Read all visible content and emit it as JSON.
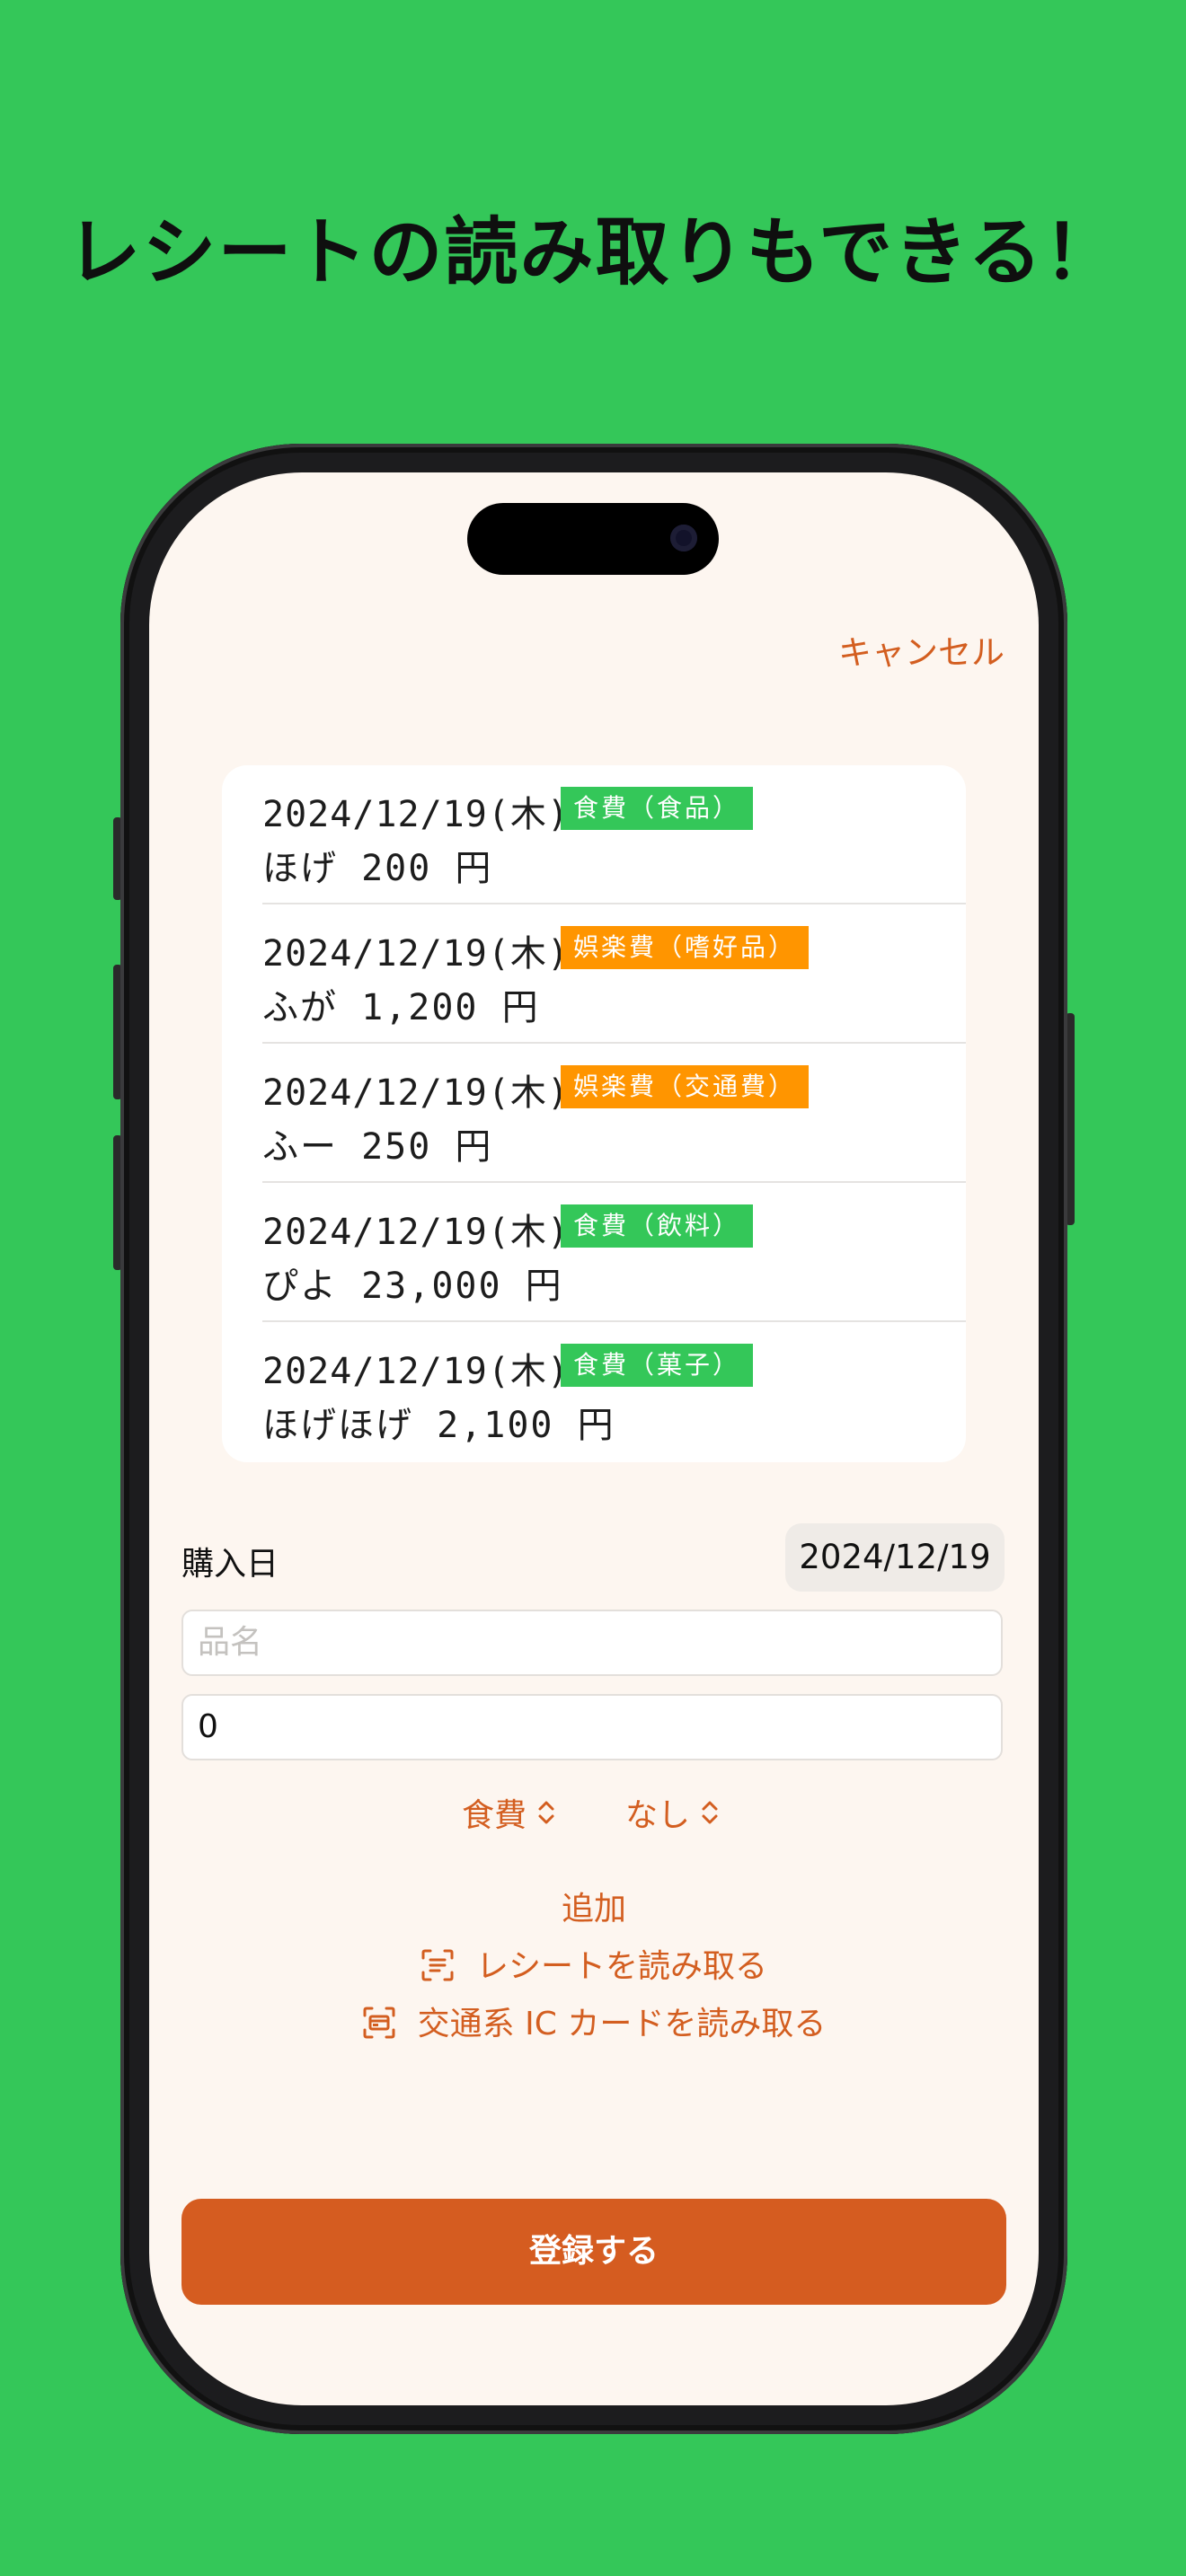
{
  "headline": "レシートの読み取りもできる！",
  "colors": {
    "background": "#34c759",
    "accent": "#d35e20",
    "tag_food": "#34c759",
    "tag_entertainment": "#ff9500"
  },
  "header": {
    "cancel_label": "キャンセル"
  },
  "entries": [
    {
      "date": "2024/12/19(木)",
      "category": "食費（食品）",
      "category_color": "#34c759",
      "item": "ほげ 200 円"
    },
    {
      "date": "2024/12/19(木)",
      "category": "娯楽費（嗜好品）",
      "category_color": "#ff9500",
      "item": "ふが 1,200 円"
    },
    {
      "date": "2024/12/19(木)",
      "category": "娯楽費（交通費）",
      "category_color": "#ff9500",
      "item": "ふー 250 円"
    },
    {
      "date": "2024/12/19(木)",
      "category": "食費（飲料）",
      "category_color": "#34c759",
      "item": "ぴよ 23,000 円"
    },
    {
      "date": "2024/12/19(木)",
      "category": "食費（菓子）",
      "category_color": "#34c759",
      "item": "ほげほげ 2,100 円"
    }
  ],
  "form": {
    "purchase_date_label": "購入日",
    "purchase_date_value": "2024/12/19",
    "name_placeholder": "品名",
    "name_value": "",
    "amount_value": "0",
    "category_picker": "食費",
    "subcategory_picker": "なし",
    "add_label": "追加",
    "scan_receipt_label": "レシートを読み取る",
    "scan_ic_card_label": "交通系 IC カードを読み取る",
    "submit_label": "登録する"
  },
  "icons": {
    "picker": "chevron-up-down-icon",
    "receipt_scan": "doc-viewfinder-icon",
    "card_scan": "card-viewfinder-icon"
  }
}
